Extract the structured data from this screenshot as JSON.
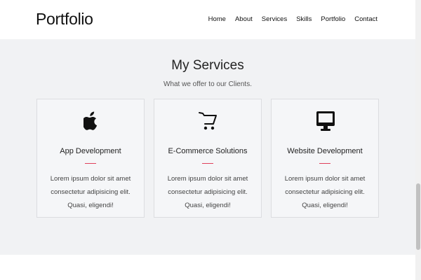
{
  "header": {
    "logo": "Portfolio",
    "nav": [
      "Home",
      "About",
      "Services",
      "Skills",
      "Portfolio",
      "Contact"
    ]
  },
  "services": {
    "title": "My Services",
    "subtitle": "What we offer to our Clients.",
    "accent_color": "#e0405a",
    "cards": [
      {
        "icon": "apple-icon",
        "title": "App Development",
        "text": "Lorem ipsum dolor sit amet consectetur adipisicing elit. Quasi, eligendi!"
      },
      {
        "icon": "shopping-cart-icon",
        "title": "E-Commerce Solutions",
        "text": "Lorem ipsum dolor sit amet consectetur adipisicing elit. Quasi, eligendi!"
      },
      {
        "icon": "desktop-icon",
        "title": "Website Development",
        "text": "Lorem ipsum dolor sit amet consectetur adipisicing elit. Quasi, eligendi!"
      }
    ]
  }
}
